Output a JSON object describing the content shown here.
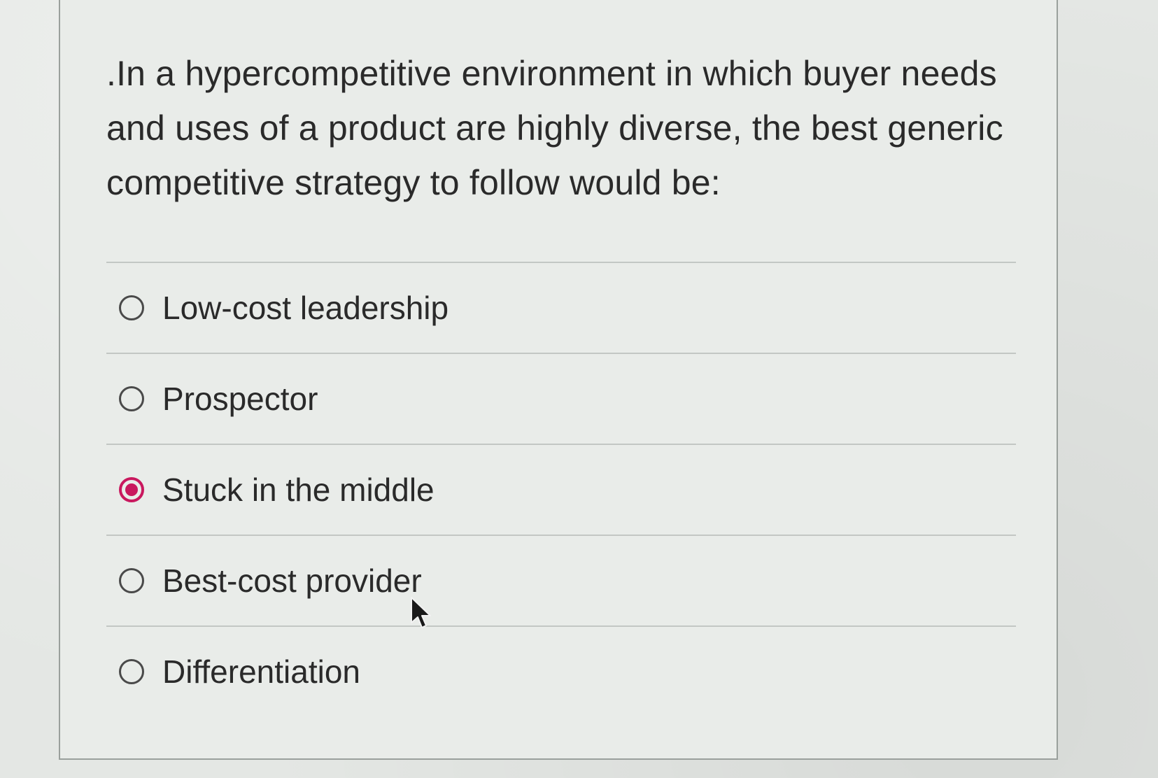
{
  "question": {
    "text": ".In a hypercompetitive environment in which buyer needs and uses of a product are highly diverse, the best generic competitive strategy to follow would be:"
  },
  "options": [
    {
      "label": "Low-cost leadership",
      "selected": false
    },
    {
      "label": "Prospector",
      "selected": false
    },
    {
      "label": "Stuck in the middle",
      "selected": true
    },
    {
      "label": "Best-cost provider",
      "selected": false
    },
    {
      "label": "Differentiation",
      "selected": false
    }
  ],
  "colors": {
    "selected_accent": "#c9185e",
    "radio_border": "#4a4a4a",
    "background": "#e4e7e4"
  },
  "icons": {
    "cursor": "arrow-cursor-icon",
    "radio_unselected": "radio-empty-icon",
    "radio_selected": "radio-filled-icon"
  }
}
